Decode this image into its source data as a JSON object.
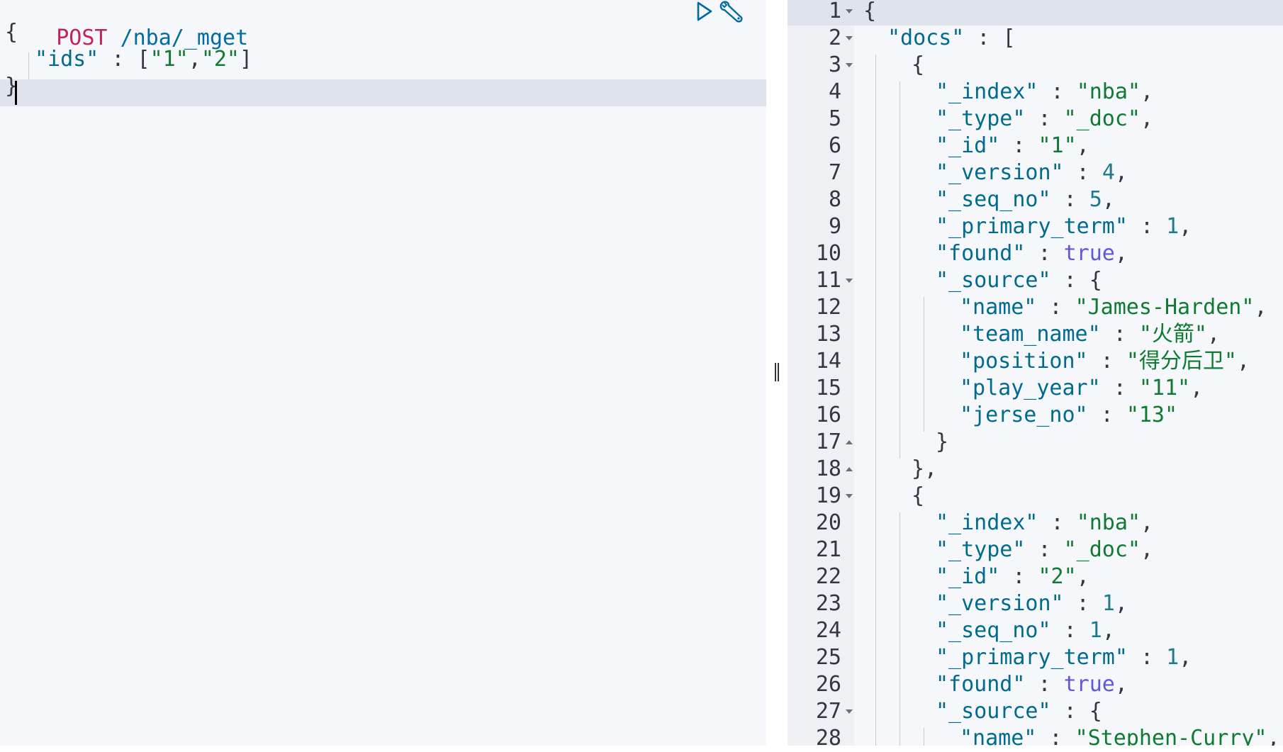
{
  "request_editor": {
    "method": "POST",
    "path": "/nba/_mget",
    "body_lines": [
      {
        "tokens": [
          {
            "t": "{",
            "c": "punc"
          }
        ]
      },
      {
        "tokens": [
          {
            "t": "\"ids\"",
            "c": "key"
          },
          {
            "t": " : [",
            "c": "punc"
          },
          {
            "t": "\"1\"",
            "c": "str"
          },
          {
            "t": ",",
            "c": "punc"
          },
          {
            "t": "\"2\"",
            "c": "str"
          },
          {
            "t": "]",
            "c": "punc"
          }
        ]
      },
      {
        "tokens": [
          {
            "t": "}",
            "c": "punc"
          }
        ]
      }
    ],
    "actions": {
      "run_icon": "play-icon",
      "settings_icon": "wrench-icon"
    }
  },
  "resizer_icon": "vertical-grip-icon",
  "response_viewer": {
    "lines": [
      {
        "n": "1",
        "fold": "down",
        "tokens": [
          {
            "t": "{",
            "c": "punc"
          }
        ]
      },
      {
        "n": "2",
        "fold": "down",
        "tokens": [
          {
            "t": "\"docs\"",
            "c": "key"
          },
          {
            "t": " : [",
            "c": "punc"
          }
        ]
      },
      {
        "n": "3",
        "fold": "down",
        "tokens": [
          {
            "t": "{",
            "c": "punc"
          }
        ]
      },
      {
        "n": "4",
        "fold": "",
        "tokens": [
          {
            "t": "\"_index\"",
            "c": "key"
          },
          {
            "t": " : ",
            "c": "punc"
          },
          {
            "t": "\"nba\"",
            "c": "str"
          },
          {
            "t": ",",
            "c": "punc"
          }
        ]
      },
      {
        "n": "5",
        "fold": "",
        "tokens": [
          {
            "t": "\"_type\"",
            "c": "key"
          },
          {
            "t": " : ",
            "c": "punc"
          },
          {
            "t": "\"_doc\"",
            "c": "str"
          },
          {
            "t": ",",
            "c": "punc"
          }
        ]
      },
      {
        "n": "6",
        "fold": "",
        "tokens": [
          {
            "t": "\"_id\"",
            "c": "key"
          },
          {
            "t": " : ",
            "c": "punc"
          },
          {
            "t": "\"1\"",
            "c": "str"
          },
          {
            "t": ",",
            "c": "punc"
          }
        ]
      },
      {
        "n": "7",
        "fold": "",
        "tokens": [
          {
            "t": "\"_version\"",
            "c": "key"
          },
          {
            "t": " : ",
            "c": "punc"
          },
          {
            "t": "4",
            "c": "num"
          },
          {
            "t": ",",
            "c": "punc"
          }
        ]
      },
      {
        "n": "8",
        "fold": "",
        "tokens": [
          {
            "t": "\"_seq_no\"",
            "c": "key"
          },
          {
            "t": " : ",
            "c": "punc"
          },
          {
            "t": "5",
            "c": "num"
          },
          {
            "t": ",",
            "c": "punc"
          }
        ]
      },
      {
        "n": "9",
        "fold": "",
        "tokens": [
          {
            "t": "\"_primary_term\"",
            "c": "key"
          },
          {
            "t": " : ",
            "c": "punc"
          },
          {
            "t": "1",
            "c": "num"
          },
          {
            "t": ",",
            "c": "punc"
          }
        ]
      },
      {
        "n": "10",
        "fold": "",
        "tokens": [
          {
            "t": "\"found\"",
            "c": "key"
          },
          {
            "t": " : ",
            "c": "punc"
          },
          {
            "t": "true",
            "c": "bool"
          },
          {
            "t": ",",
            "c": "punc"
          }
        ]
      },
      {
        "n": "11",
        "fold": "down",
        "tokens": [
          {
            "t": "\"_source\"",
            "c": "key"
          },
          {
            "t": " : {",
            "c": "punc"
          }
        ]
      },
      {
        "n": "12",
        "fold": "",
        "tokens": [
          {
            "t": "\"name\"",
            "c": "key"
          },
          {
            "t": " : ",
            "c": "punc"
          },
          {
            "t": "\"James-Harden\"",
            "c": "str"
          },
          {
            "t": ",",
            "c": "punc"
          }
        ]
      },
      {
        "n": "13",
        "fold": "",
        "tokens": [
          {
            "t": "\"team_name\"",
            "c": "key"
          },
          {
            "t": " : ",
            "c": "punc"
          },
          {
            "t": "\"火箭\"",
            "c": "str"
          },
          {
            "t": ",",
            "c": "punc"
          }
        ]
      },
      {
        "n": "14",
        "fold": "",
        "tokens": [
          {
            "t": "\"position\"",
            "c": "key"
          },
          {
            "t": " : ",
            "c": "punc"
          },
          {
            "t": "\"得分后卫\"",
            "c": "str"
          },
          {
            "t": ",",
            "c": "punc"
          }
        ]
      },
      {
        "n": "15",
        "fold": "",
        "tokens": [
          {
            "t": "\"play_year\"",
            "c": "key"
          },
          {
            "t": " : ",
            "c": "punc"
          },
          {
            "t": "\"11\"",
            "c": "str"
          },
          {
            "t": ",",
            "c": "punc"
          }
        ]
      },
      {
        "n": "16",
        "fold": "",
        "tokens": [
          {
            "t": "\"jerse_no\"",
            "c": "key"
          },
          {
            "t": " : ",
            "c": "punc"
          },
          {
            "t": "\"13\"",
            "c": "str"
          }
        ]
      },
      {
        "n": "17",
        "fold": "up",
        "tokens": [
          {
            "t": "}",
            "c": "punc"
          }
        ]
      },
      {
        "n": "18",
        "fold": "up",
        "tokens": [
          {
            "t": "},",
            "c": "punc"
          }
        ]
      },
      {
        "n": "19",
        "fold": "down",
        "tokens": [
          {
            "t": "{",
            "c": "punc"
          }
        ]
      },
      {
        "n": "20",
        "fold": "",
        "tokens": [
          {
            "t": "\"_index\"",
            "c": "key"
          },
          {
            "t": " : ",
            "c": "punc"
          },
          {
            "t": "\"nba\"",
            "c": "str"
          },
          {
            "t": ",",
            "c": "punc"
          }
        ]
      },
      {
        "n": "21",
        "fold": "",
        "tokens": [
          {
            "t": "\"_type\"",
            "c": "key"
          },
          {
            "t": " : ",
            "c": "punc"
          },
          {
            "t": "\"_doc\"",
            "c": "str"
          },
          {
            "t": ",",
            "c": "punc"
          }
        ]
      },
      {
        "n": "22",
        "fold": "",
        "tokens": [
          {
            "t": "\"_id\"",
            "c": "key"
          },
          {
            "t": " : ",
            "c": "punc"
          },
          {
            "t": "\"2\"",
            "c": "str"
          },
          {
            "t": ",",
            "c": "punc"
          }
        ]
      },
      {
        "n": "23",
        "fold": "",
        "tokens": [
          {
            "t": "\"_version\"",
            "c": "key"
          },
          {
            "t": " : ",
            "c": "punc"
          },
          {
            "t": "1",
            "c": "num"
          },
          {
            "t": ",",
            "c": "punc"
          }
        ]
      },
      {
        "n": "24",
        "fold": "",
        "tokens": [
          {
            "t": "\"_seq_no\"",
            "c": "key"
          },
          {
            "t": " : ",
            "c": "punc"
          },
          {
            "t": "1",
            "c": "num"
          },
          {
            "t": ",",
            "c": "punc"
          }
        ]
      },
      {
        "n": "25",
        "fold": "",
        "tokens": [
          {
            "t": "\"_primary_term\"",
            "c": "key"
          },
          {
            "t": " : ",
            "c": "punc"
          },
          {
            "t": "1",
            "c": "num"
          },
          {
            "t": ",",
            "c": "punc"
          }
        ]
      },
      {
        "n": "26",
        "fold": "",
        "tokens": [
          {
            "t": "\"found\"",
            "c": "key"
          },
          {
            "t": " : ",
            "c": "punc"
          },
          {
            "t": "true",
            "c": "bool"
          },
          {
            "t": ",",
            "c": "punc"
          }
        ]
      },
      {
        "n": "27",
        "fold": "down",
        "tokens": [
          {
            "t": "\"_source\"",
            "c": "key"
          },
          {
            "t": " : {",
            "c": "punc"
          }
        ]
      },
      {
        "n": "28",
        "fold": "",
        "tokens": [
          {
            "t": "\"name\"",
            "c": "key"
          },
          {
            "t": " : ",
            "c": "punc"
          },
          {
            "t": "\"Stephen-Curry\"",
            "c": "str"
          },
          {
            "t": ",",
            "c": "punc"
          }
        ]
      }
    ]
  },
  "colors": {
    "method": "#c4225f",
    "key": "#006b8f",
    "string": "#0f7b32",
    "number": "#1d7a8c",
    "boolean": "#6158d9",
    "editor_bg": "#f5f7fa",
    "active_line": "#dfe4ec"
  }
}
